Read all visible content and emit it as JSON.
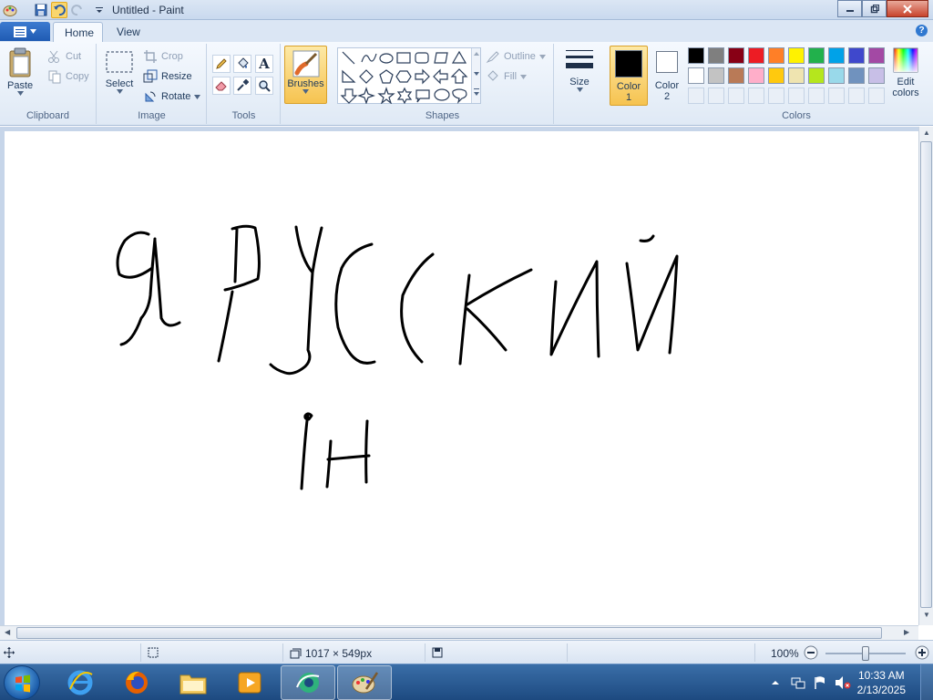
{
  "window": {
    "title": "Untitled - Paint"
  },
  "menu": {
    "tabs": [
      "Home",
      "View"
    ]
  },
  "ribbon": {
    "clipboard": {
      "label": "Clipboard",
      "paste": "Paste",
      "cut": "Cut",
      "copy": "Copy"
    },
    "image": {
      "label": "Image",
      "select": "Select",
      "crop": "Crop",
      "resize": "Resize",
      "rotate": "Rotate"
    },
    "tools": {
      "label": "Tools"
    },
    "brushes": {
      "label": "Brushes"
    },
    "shapes": {
      "label": "Shapes",
      "outline": "Outline",
      "fill": "Fill"
    },
    "size": {
      "label": "Size"
    },
    "color1": {
      "label_line1": "Color",
      "label_line2": "1",
      "value": "#000000"
    },
    "color2": {
      "label_line1": "Color",
      "label_line2": "2",
      "value": "#ffffff"
    },
    "colors": {
      "label": "Colors",
      "edit_line1": "Edit",
      "edit_line2": "colors",
      "row1": [
        "#000000",
        "#7f7f7f",
        "#880015",
        "#ed1c24",
        "#ff7f27",
        "#fff200",
        "#22b14c",
        "#00a2e8",
        "#3f48cc",
        "#a349a4"
      ],
      "row2": [
        "#ffffff",
        "#c3c3c3",
        "#b97a57",
        "#ffaec9",
        "#ffc90e",
        "#efe4b0",
        "#b5e61d",
        "#99d9ea",
        "#7092be",
        "#c8bfe7"
      ]
    }
  },
  "status": {
    "dimensions": "1017 × 549px",
    "zoom": "100%"
  },
  "clock": {
    "time": "10:33 AM",
    "date": "2/13/2025"
  }
}
